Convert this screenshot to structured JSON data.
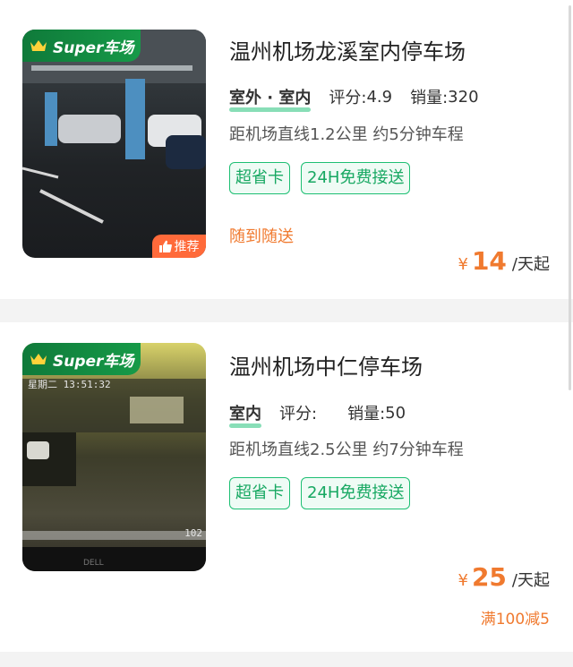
{
  "listings": [
    {
      "badge": "Super车场",
      "recommend": "推荐",
      "title": "温州机场龙溪室内停车场",
      "environment": "室外 · 室内",
      "rating_label": "评分:",
      "rating": "4.9",
      "sales_label": "销量:",
      "sales": "320",
      "distance": "距机场直线1.2公里 约5分钟车程",
      "tags": [
        "超省卡",
        "24H免费接送"
      ],
      "service": "随到随送",
      "currency": "¥",
      "price": "14",
      "price_unit": "/天起"
    },
    {
      "badge": "Super车场",
      "cam_time": "星期二 13:51:32",
      "cam_num": "102",
      "title": "温州机场中仁停车场",
      "environment": "室内",
      "rating_label": "评分:",
      "rating": "",
      "sales_label": "销量:",
      "sales": "50",
      "distance": "距机场直线2.5公里 约7分钟车程",
      "tags": [
        "超省卡",
        "24H免费接送"
      ],
      "currency": "¥",
      "price": "25",
      "price_unit": "/天起",
      "discount": "满100减5"
    }
  ],
  "colors": {
    "brand_green": "#169a48",
    "accent_orange": "#f07a2f",
    "tag_green": "#17a862"
  }
}
